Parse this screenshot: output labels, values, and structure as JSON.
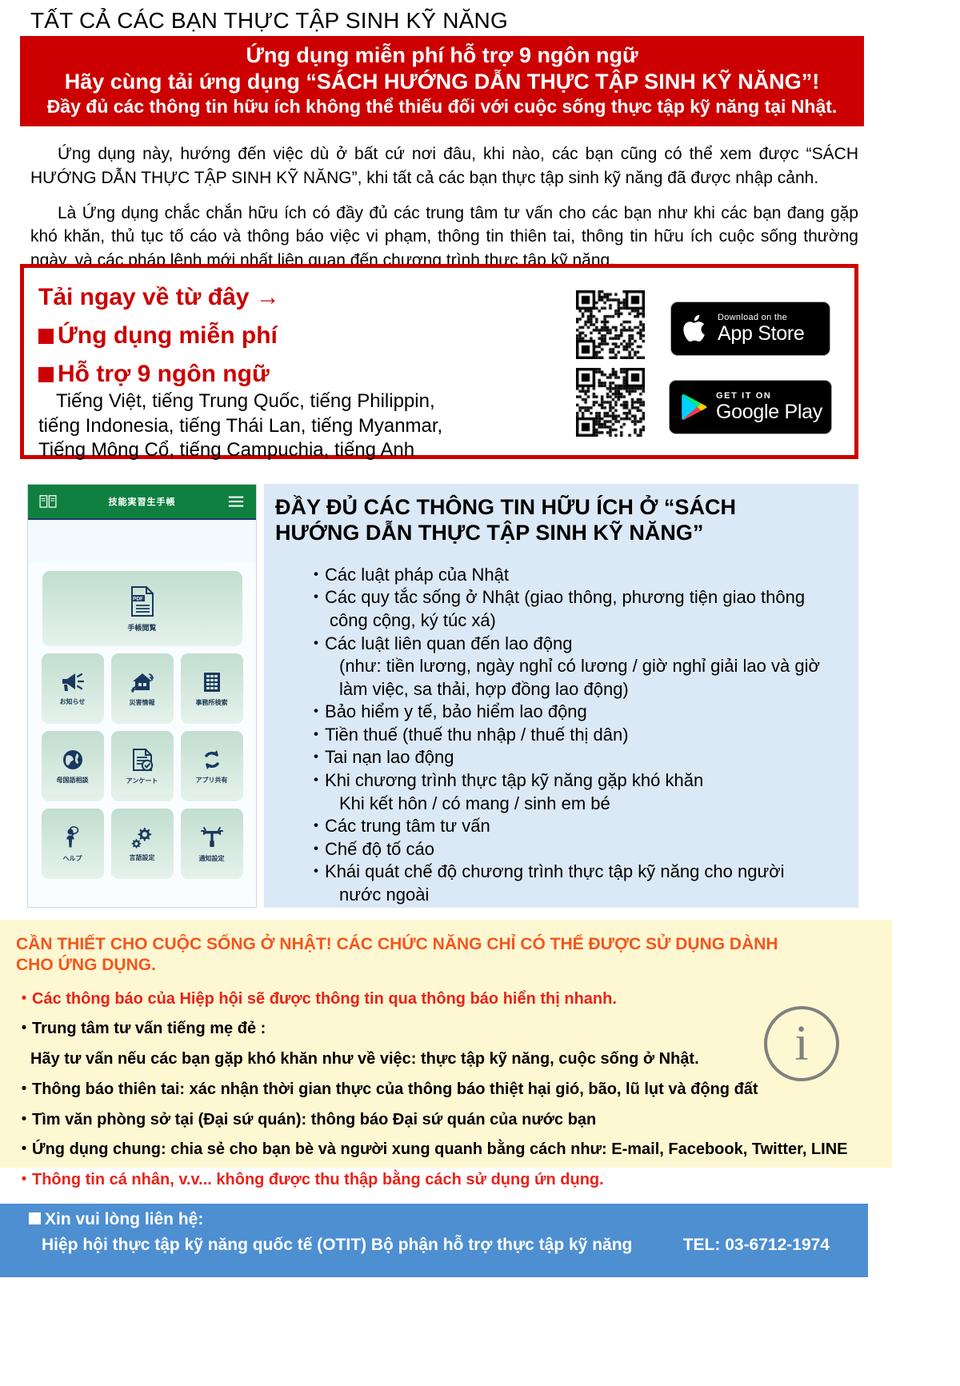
{
  "doc": {
    "title": "TẤT CẢ CÁC BẠN THỰC TẬP SINH KỸ NĂNG"
  },
  "banner": {
    "line1": "Ứng dụng miễn phí hỗ trợ 9 ngôn ngữ",
    "line2": "Hãy cùng tải ứng dụng “SÁCH HƯỚNG DẪN THỰC TẬP SINH KỸ NĂNG”!",
    "line3": "Đầy đủ các thông tin hữu ích không thể thiếu đối với cuộc sống thực tập kỹ năng tại Nhật.",
    "bg_color": "#cc0000"
  },
  "intro": {
    "p1": "Ứng dụng này, hướng đến việc dù ở bất cứ nơi đâu, khi nào, các bạn cũng có thể xem được “SÁCH HƯỚNG DẪN THỰC TẬP SINH KỸ NĂNG”, khi tất cả các bạn thực tập sinh kỹ năng đã được nhập cảnh.",
    "p2": "Là Ứng dụng chắc chắn hữu ích có đầy đủ các trung tâm tư vấn cho các bạn như khi các bạn đang gặp khó khăn, thủ tục tố cáo và thông báo việc vi phạm, thông tin thiên tai, thông tin hữu ích cuộc sống thường ngày, và các pháp lệnh mới nhất liên quan đến chương trình thực tập kỹ năng."
  },
  "download": {
    "heading": "Tải ngay về từ đây →",
    "bullet1": "Ứng dụng miễn phí",
    "bullet2": "Hỗ trợ 9 ngôn ngữ",
    "languages_line1": "Tiếng Việt, tiếng Trung Quốc, tiếng Philippin,",
    "languages_line2": "tiếng Indonesia, tiếng Thái Lan, tiếng Myanmar,",
    "languages_line3": "Tiếng Mông Cổ, tiếng Campuchia, tiếng Anh",
    "accent_color": "#cc0000",
    "apple_badge": {
      "small": "Download on the",
      "big": "App Store"
    },
    "google_badge": {
      "small": "GET IT ON",
      "big": "Google Play"
    },
    "qr_apple_name": "qr-code-app-store",
    "qr_google_name": "qr-code-google-play"
  },
  "phone": {
    "app_title": "技能実習生手帳",
    "menu_icon": "hamburger-icon",
    "book_icon": "book-icon",
    "feature_tile": {
      "label": "手帳閲覧",
      "icon": "pdf-document-icon"
    },
    "tiles": [
      {
        "label": "お知らせ",
        "icon": "megaphone-icon"
      },
      {
        "label": "災害情報",
        "icon": "house-shaking-icon"
      },
      {
        "label": "事務所検索",
        "icon": "office-building-icon"
      },
      {
        "label": "母国語相談",
        "icon": "globe-icon"
      },
      {
        "label": "アンケート",
        "icon": "survey-check-icon"
      },
      {
        "label": "アプリ共有",
        "icon": "share-refresh-icon"
      },
      {
        "label": "ヘルプ",
        "icon": "person-help-icon"
      },
      {
        "label": "言語設定",
        "icon": "gears-icon"
      },
      {
        "label": "通知設定",
        "icon": "notification-tower-icon"
      }
    ],
    "header_color": "#108040"
  },
  "blue_panel": {
    "title_line1": "ĐẦY ĐỦ CÁC THÔNG TIN HỮU ÍCH Ở “SÁCH",
    "title_line2": "HƯỚNG DẪN THỰC TẬP SINH KỸ NĂNG”",
    "bg_color": "#dbe8f6",
    "items": [
      {
        "type": "dot",
        "text": "Các luật pháp của Nhật"
      },
      {
        "type": "dot",
        "text": "Các quy tắc sống ở Nhật (giao thông, phương tiện giao thông"
      },
      {
        "type": "cont2",
        "text": "công cộng, ký túc xá)"
      },
      {
        "type": "dot",
        "text": "Các luật liên quan đến lao động"
      },
      {
        "type": "cont",
        "text": "(như: tiền lương, ngày nghỉ có lương / giờ nghỉ giải lao và giờ"
      },
      {
        "type": "cont",
        "text": "làm việc, sa thải, hợp đồng lao động)"
      },
      {
        "type": "dot",
        "text": "Bảo hiểm y tế, bảo hiểm lao động"
      },
      {
        "type": "dot",
        "text": "Tiền thuế (thuế thu nhập / thuế thị dân)"
      },
      {
        "type": "dot",
        "text": "Tai nạn lao động"
      },
      {
        "type": "dot",
        "text": "Khi chương trình thực tập kỹ năng gặp khó khăn"
      },
      {
        "type": "cont",
        "text": "Khi kết hôn / có mang / sinh em bé"
      },
      {
        "type": "dot",
        "text": "Các trung tâm tư vấn"
      },
      {
        "type": "dot",
        "text": "Chế độ tố cáo"
      },
      {
        "type": "dot",
        "text": "Khái quát chế độ chương trình thực tập kỹ năng cho người"
      },
      {
        "type": "cont",
        "text": "nước ngoài"
      }
    ]
  },
  "yellow_panel": {
    "bg_color": "#fdf7d2",
    "heading_color": "#f4561d",
    "heading_line1": "CẦN THIẾT CHO CUỘC SỐNG Ở NHẬT! CÁC CHỨC NĂNG CHỈ CÓ THỂ ĐƯỢC SỬ DỤNG DÀNH",
    "heading_line2": "CHO ỨNG DỤNG.",
    "items": [
      {
        "text": "Các thông báo của Hiệp hội sẽ được thông tin qua thông báo hiển thị nhanh.",
        "color": "red",
        "bullet": true
      },
      {
        "text": "Trung tâm tư vấn tiếng mẹ đẻ :",
        "color": "black",
        "bullet": true
      },
      {
        "text": "Hãy tư vấn nếu các bạn gặp khó khăn như về việc: thực tập kỹ năng, cuộc sống ở Nhật.",
        "color": "black",
        "bullet": false
      },
      {
        "text": "Thông báo thiên tai: xác nhận thời gian thực của thông báo thiệt hại gió, bão, lũ lụt và động đất",
        "color": "black",
        "bullet": true
      },
      {
        "text": "Tìm văn phòng sở tại (Đại sứ quán): thông báo Đại sứ quán của nước bạn",
        "color": "black",
        "bullet": true
      },
      {
        "text": "Ứng dụng chung: chia sẻ cho bạn bè và người xung quanh bằng cách như: E-mail, Facebook, Twitter, LINE",
        "color": "black",
        "bullet": true
      },
      {
        "text": "Thông tin cá nhân, v.v... không được thu thập bằng cách sử dụng ứn dụng.",
        "color": "red",
        "bullet": true
      }
    ],
    "info_icon": "i"
  },
  "footer": {
    "bg_color": "#4d8fd1",
    "contact_label": "Xin vui lòng liên hệ:",
    "org": "Hiệp hội thực tập kỹ năng quốc tế (OTIT) Bộ phận hỗ trợ thực tập kỹ năng",
    "tel": "TEL: 03-6712-1974"
  }
}
